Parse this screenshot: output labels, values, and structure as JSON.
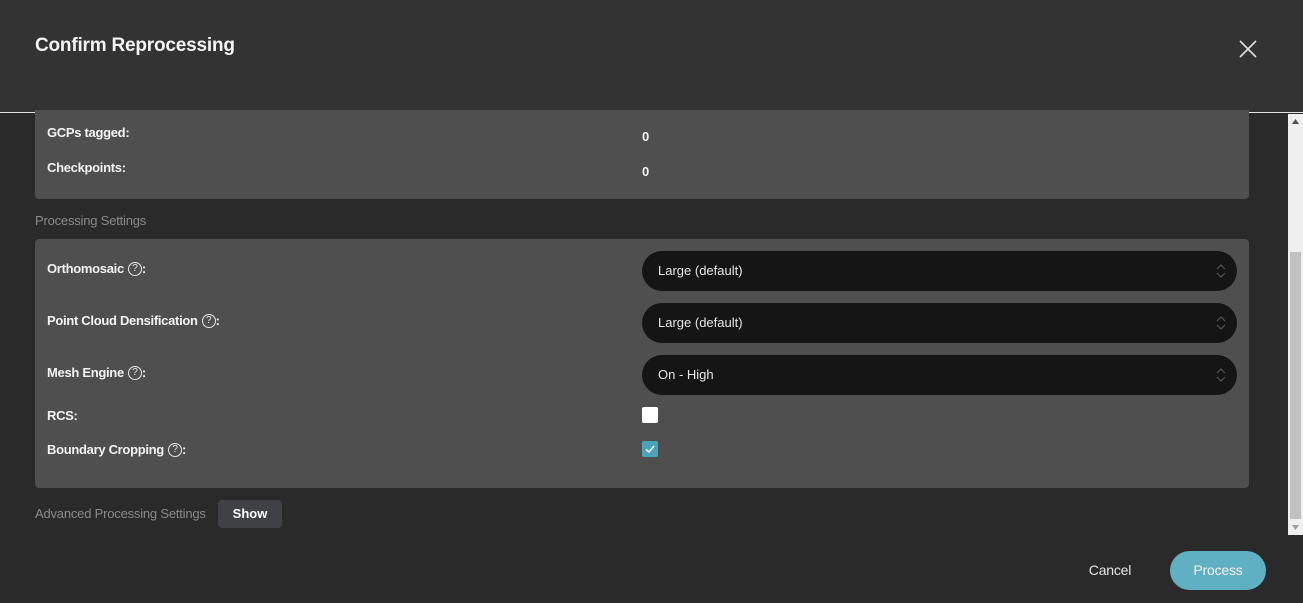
{
  "dialog": {
    "title": "Confirm Reprocessing",
    "close_icon": "close-icon"
  },
  "summary": {
    "rows": [
      {
        "label": "GCPs tagged:",
        "value": "0"
      },
      {
        "label": "Checkpoints:",
        "value": "0"
      }
    ]
  },
  "processing_settings": {
    "heading": "Processing Settings",
    "orthomosaic": {
      "label": "Orthomosaic",
      "suffix": ":",
      "help_icon": "help-circle-icon",
      "value": "Large (default)"
    },
    "point_cloud": {
      "label": "Point Cloud Densification",
      "suffix": ":",
      "help_icon": "help-circle-icon",
      "value": "Large (default)"
    },
    "mesh_engine": {
      "label": "Mesh Engine",
      "suffix": ":",
      "help_icon": "help-circle-icon",
      "value": "On - High"
    },
    "rcs": {
      "label": "RCS:",
      "checked": false
    },
    "boundary_cropping": {
      "label": "Boundary Cropping",
      "suffix": ":",
      "help_icon": "help-circle-icon",
      "checked": true
    }
  },
  "advanced": {
    "label": "Advanced Processing Settings",
    "show_label": "Show"
  },
  "footer": {
    "cancel_label": "Cancel",
    "process_label": "Process"
  },
  "help_glyph": "?",
  "colors": {
    "accent": "#5fb0c2",
    "checkbox_on": "#4aa3b8",
    "panel": "#4f4f4f",
    "header": "#333333",
    "select_bg": "#151515"
  }
}
